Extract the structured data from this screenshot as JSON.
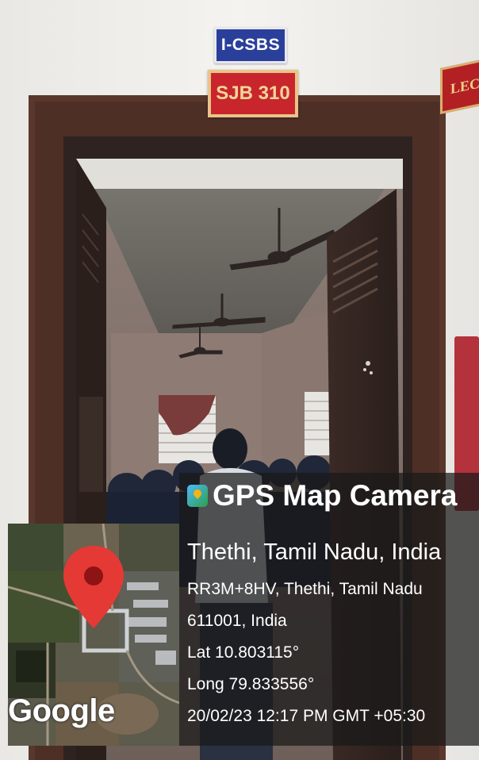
{
  "signs": {
    "dept": "I-CSBS",
    "room": "SJB 310",
    "side": "LECT"
  },
  "stamp": {
    "app_name": "GPS Map Camera",
    "place": "Thethi, Tamil Nadu, India",
    "address_line1": "RR3M+8HV, Thethi, Tamil Nadu",
    "address_line2": "611001, India",
    "latitude": "Lat 10.803115°",
    "longitude": "Long 79.833556°",
    "datetime": "20/02/23 12:17 PM GMT +05:30",
    "map_brand": "Google"
  },
  "colors": {
    "wall": "#f1f0ec",
    "door_frame": "#5a372c",
    "dept_sign": "#2a3f9a",
    "room_sign": "#c8262c",
    "map_pin": "#e53935"
  },
  "icons": {
    "app": "gps-map-camera-icon",
    "pin": "map-pin-icon"
  }
}
